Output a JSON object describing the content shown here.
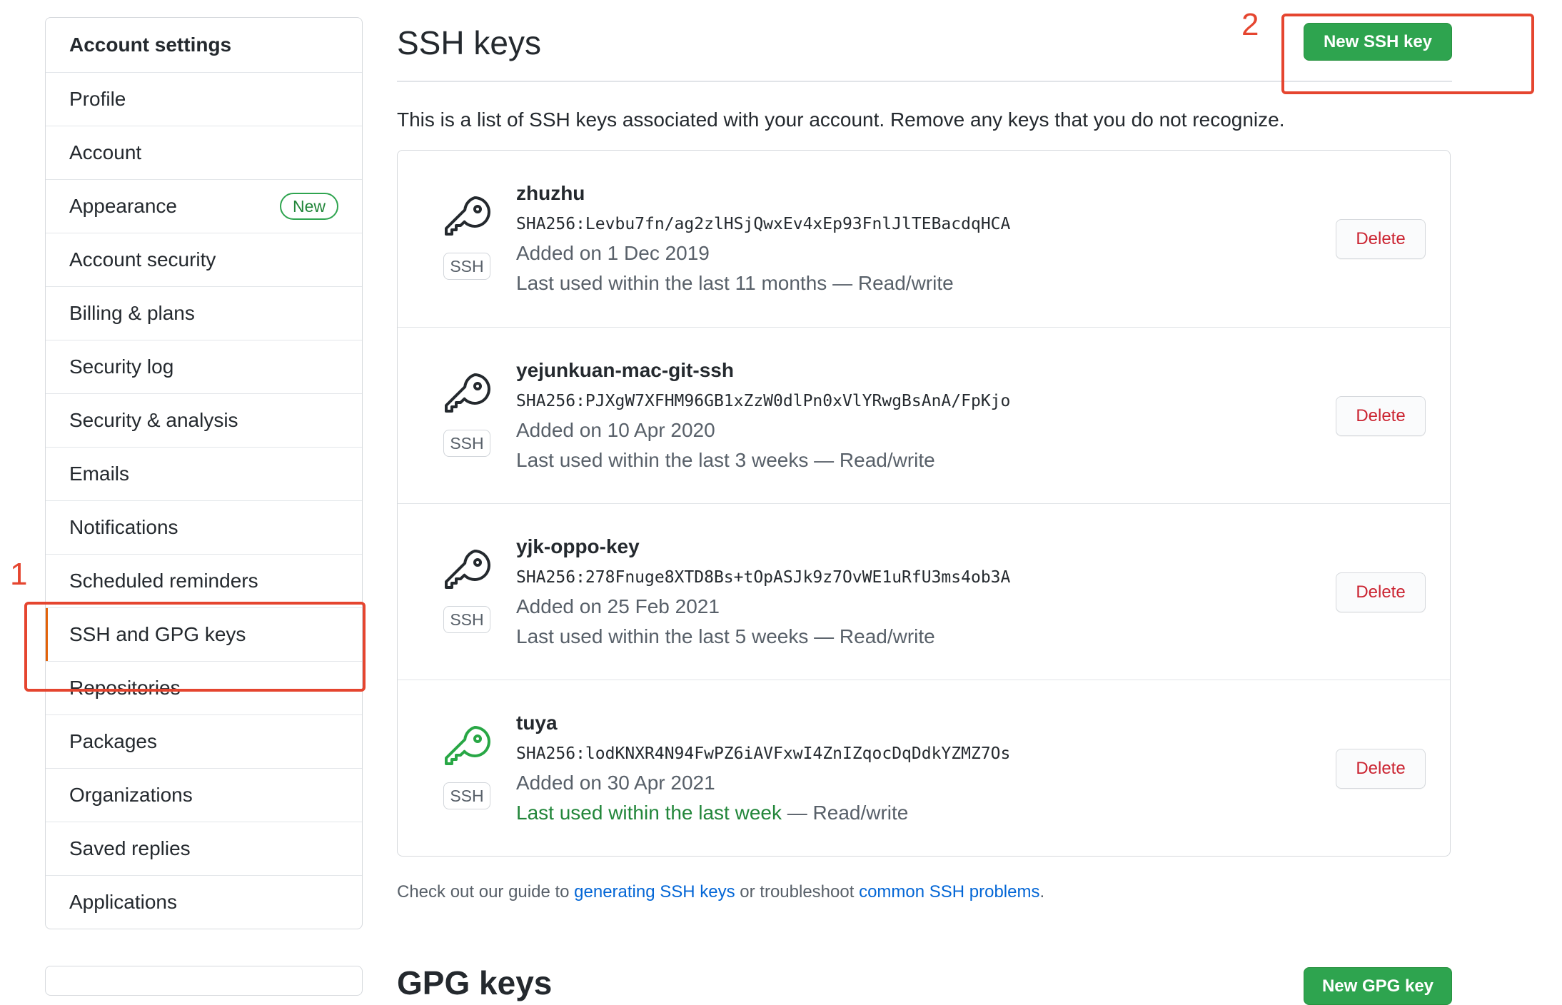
{
  "sidebar": {
    "header": "Account settings",
    "items": [
      {
        "label": "Profile"
      },
      {
        "label": "Account"
      },
      {
        "label": "Appearance",
        "badge": "New"
      },
      {
        "label": "Account security"
      },
      {
        "label": "Billing & plans"
      },
      {
        "label": "Security log"
      },
      {
        "label": "Security & analysis"
      },
      {
        "label": "Emails"
      },
      {
        "label": "Notifications"
      },
      {
        "label": "Scheduled reminders"
      },
      {
        "label": "SSH and GPG keys",
        "selected": true
      },
      {
        "label": "Repositories"
      },
      {
        "label": "Packages"
      },
      {
        "label": "Organizations"
      },
      {
        "label": "Saved replies"
      },
      {
        "label": "Applications"
      }
    ]
  },
  "main": {
    "title": "SSH keys",
    "new_key_button": "New SSH key",
    "intro": "This is a list of SSH keys associated with your account. Remove any keys that you do not recognize.",
    "ssh_label": "SSH",
    "delete_label": "Delete",
    "keys": [
      {
        "name": "zhuzhu",
        "fingerprint": "SHA256:Levbu7fn/ag2zlHSjQwxEv4xEp93FnlJlTEBacdqHCA",
        "added": "Added on 1 Dec 2019",
        "last_used": "Last used within the last 11 months",
        "access": " — Read/write",
        "recent": false
      },
      {
        "name": "yejunkuan-mac-git-ssh",
        "fingerprint": "SHA256:PJXgW7XFHM96GB1xZzW0dlPn0xVlYRwgBsAnA/FpKjo",
        "added": "Added on 10 Apr 2020",
        "last_used": "Last used within the last 3 weeks",
        "access": " — Read/write",
        "recent": false
      },
      {
        "name": "yjk-oppo-key",
        "fingerprint": "SHA256:278Fnuge8XTD8Bs+tOpASJk9z7OvWE1uRfU3ms4ob3A",
        "added": "Added on 25 Feb 2021",
        "last_used": "Last used within the last 5 weeks",
        "access": " — Read/write",
        "recent": false
      },
      {
        "name": "tuya",
        "fingerprint": "SHA256:lodKNXR4N94FwPZ6iAVFxwI4ZnIZqocDqDdkYZMZ7Os",
        "added": "Added on 30 Apr 2021",
        "last_used": "Last used within the last week",
        "access": " — Read/write",
        "recent": true
      }
    ],
    "guide": {
      "prefix": "Check out our guide to ",
      "link1": "generating SSH keys",
      "middle": " or troubleshoot ",
      "link2": "common SSH problems",
      "suffix": "."
    },
    "gpg_title": "GPG keys",
    "new_gpg_button": "New GPG key"
  },
  "annotations": {
    "one": "1",
    "two": "2"
  },
  "colors": {
    "primary_green": "#2ea44f",
    "danger_red": "#cb2431",
    "link_blue": "#0366d6",
    "annotation_red": "#e5452f",
    "selected_bar": "#e36209"
  },
  "icons": {
    "key": "key-icon"
  }
}
